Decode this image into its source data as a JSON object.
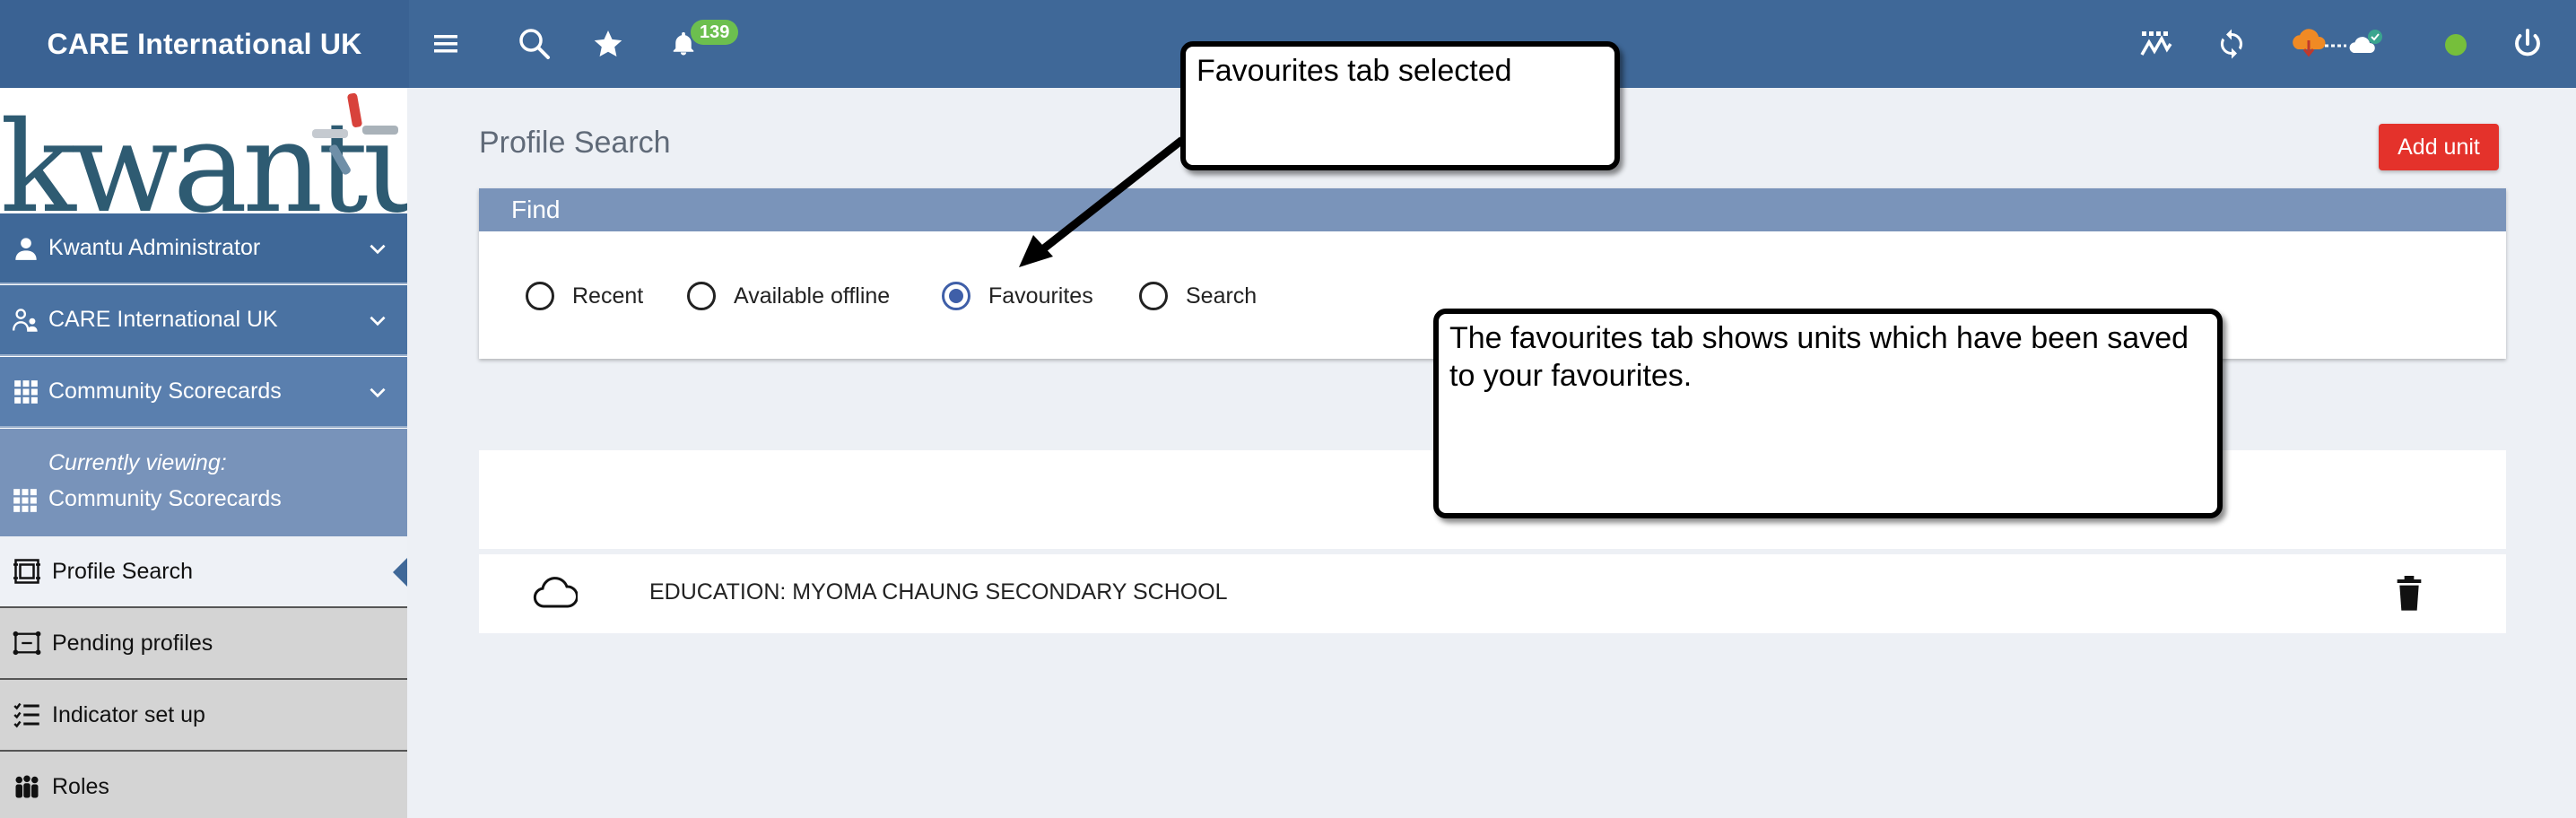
{
  "topbar": {
    "brand": "CARE International UK",
    "notification_count": "139",
    "colors": {
      "bar": "#3f6898",
      "badge": "#6cbf4f",
      "status": "#76bf3b"
    },
    "icons": [
      "menu-icon",
      "search-icon",
      "star-icon",
      "bell-icon",
      "chart-icon",
      "sync-icon",
      "upload-cloud-icon",
      "online-status-icon",
      "power-icon"
    ]
  },
  "sidebar": {
    "logo_text": "kwantu",
    "nav": [
      {
        "label": "Kwantu Administrator",
        "icon": "user-icon"
      },
      {
        "label": "CARE International UK",
        "icon": "organisation-icon"
      },
      {
        "label": "Community Scorecards",
        "icon": "apps-grid-icon"
      }
    ],
    "current": {
      "label": "Currently viewing:",
      "name": "Community Scorecards"
    },
    "sub": [
      {
        "label": "Profile Search",
        "icon": "profile-search-icon"
      },
      {
        "label": "Pending profiles",
        "icon": "pending-icon"
      },
      {
        "label": "Indicator set up",
        "icon": "checklist-icon"
      },
      {
        "label": "Roles",
        "icon": "people-icon"
      }
    ]
  },
  "main": {
    "title": "Profile Search",
    "add_unit": "Add unit",
    "find": {
      "header": "Find",
      "options": [
        "Recent",
        "Available offline",
        "Favourites",
        "Search"
      ],
      "selected": "Favourites"
    },
    "results": [
      {
        "title": "EDUCATION: MYOMA CHAUNG SECONDARY SCHOOL"
      }
    ]
  },
  "callouts": {
    "tab": "Favourites tab selected",
    "info": "The favourites tab shows units which have been saved to your favourites."
  }
}
